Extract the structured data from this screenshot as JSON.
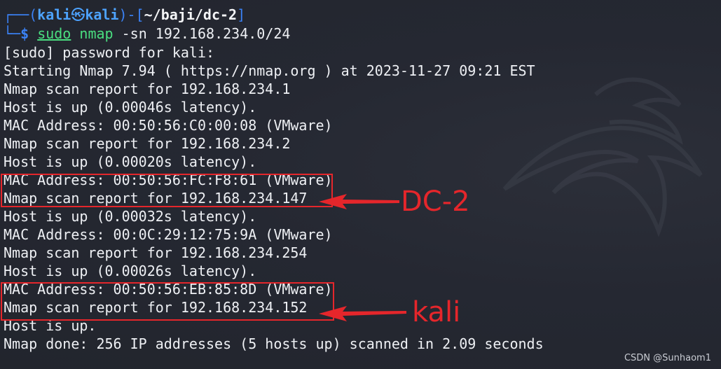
{
  "prompt": {
    "frame_top": "┌──(",
    "user": "kali",
    "skull": "㉿",
    "host": "kali",
    "frame_mid": ")-[",
    "path": "~/baji/dc-2",
    "frame_end": "]",
    "frame_bottom": "└─",
    "dollar": "$",
    "cmd_sudo": "sudo",
    "cmd_name": "nmap",
    "cmd_args": "-sn 192.168.234.0/24"
  },
  "output_lines": [
    "[sudo] password for kali:",
    "Starting Nmap 7.94 ( https://nmap.org ) at 2023-11-27 09:21 EST",
    "Nmap scan report for 192.168.234.1",
    "Host is up (0.00046s latency).",
    "MAC Address: 00:50:56:C0:00:08 (VMware)",
    "Nmap scan report for 192.168.234.2",
    "Host is up (0.00020s latency).",
    "MAC Address: 00:50:56:FC:F8:61 (VMware)",
    "Nmap scan report for 192.168.234.147",
    "Host is up (0.00032s latency).",
    "MAC Address: 00:0C:29:12:75:9A (VMware)",
    "Nmap scan report for 192.168.234.254",
    "Host is up (0.00026s latency).",
    "MAC Address: 00:50:56:EB:85:8D (VMware)",
    "Nmap scan report for 192.168.234.152",
    "Host is up.",
    "Nmap done: 256 IP addresses (5 hosts up) scanned in 2.09 seconds"
  ],
  "annotations": {
    "dc2_label": "DC-2",
    "kali_label": "kali",
    "color": "#e5262b"
  },
  "watermark": "CSDN @Sunhaom1"
}
